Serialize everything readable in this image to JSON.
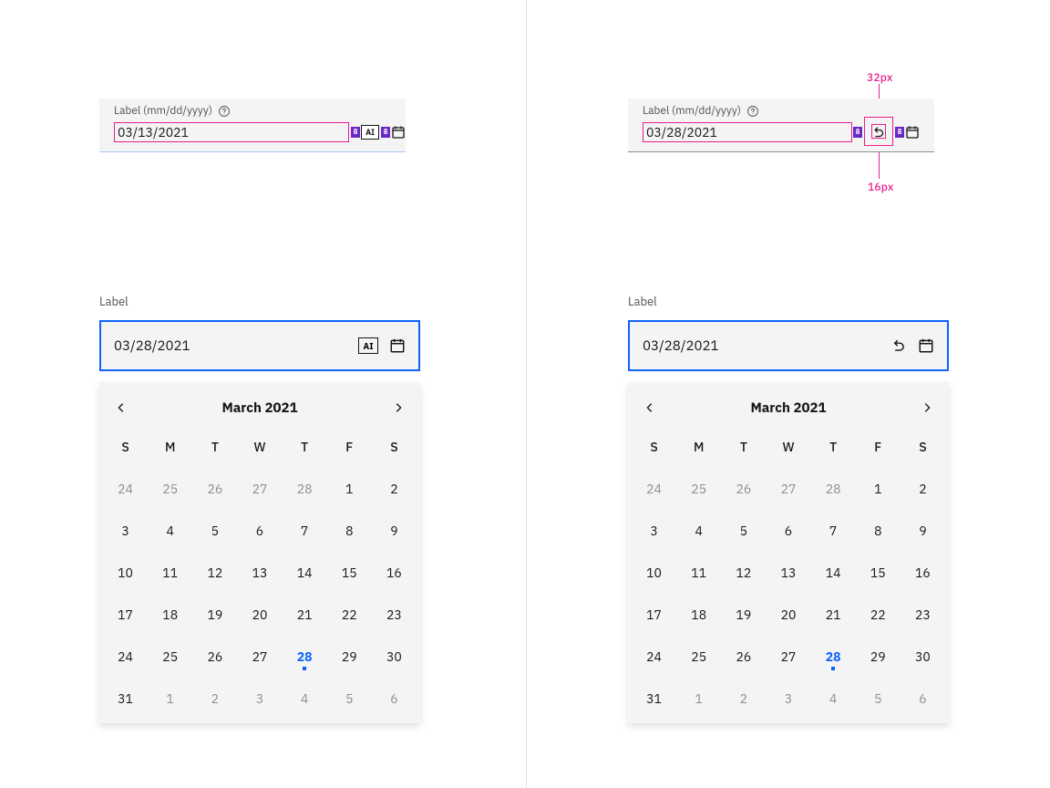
{
  "spec": {
    "label": "Label (mm/dd/yyyy)",
    "left_value": "03/13/2021",
    "right_value": "03/28/2021",
    "ai_abbrev": "AI",
    "tag8": "8",
    "dim_32": "32px",
    "dim_16": "16px"
  },
  "picker": {
    "label": "Label",
    "value": "03/28/2021",
    "month_title": "March  2021",
    "dow": [
      "S",
      "M",
      "T",
      "W",
      "T",
      "F",
      "S"
    ],
    "ai_abbrev": "AI",
    "days": [
      {
        "n": "24",
        "muted": true
      },
      {
        "n": "25",
        "muted": true
      },
      {
        "n": "26",
        "muted": true
      },
      {
        "n": "27",
        "muted": true
      },
      {
        "n": "28",
        "muted": true
      },
      {
        "n": "1"
      },
      {
        "n": "2"
      },
      {
        "n": "3"
      },
      {
        "n": "4"
      },
      {
        "n": "5"
      },
      {
        "n": "6"
      },
      {
        "n": "7"
      },
      {
        "n": "8"
      },
      {
        "n": "9"
      },
      {
        "n": "10"
      },
      {
        "n": "11"
      },
      {
        "n": "12"
      },
      {
        "n": "13"
      },
      {
        "n": "14"
      },
      {
        "n": "15"
      },
      {
        "n": "16"
      },
      {
        "n": "17"
      },
      {
        "n": "18"
      },
      {
        "n": "19"
      },
      {
        "n": "20"
      },
      {
        "n": "21"
      },
      {
        "n": "22"
      },
      {
        "n": "23"
      },
      {
        "n": "24"
      },
      {
        "n": "25"
      },
      {
        "n": "26"
      },
      {
        "n": "27"
      },
      {
        "n": "28",
        "selected": true
      },
      {
        "n": "29"
      },
      {
        "n": "30"
      },
      {
        "n": "31"
      },
      {
        "n": "1",
        "muted": true
      },
      {
        "n": "2",
        "muted": true
      },
      {
        "n": "3",
        "muted": true
      },
      {
        "n": "4",
        "muted": true
      },
      {
        "n": "5",
        "muted": true
      },
      {
        "n": "6",
        "muted": true
      }
    ]
  }
}
